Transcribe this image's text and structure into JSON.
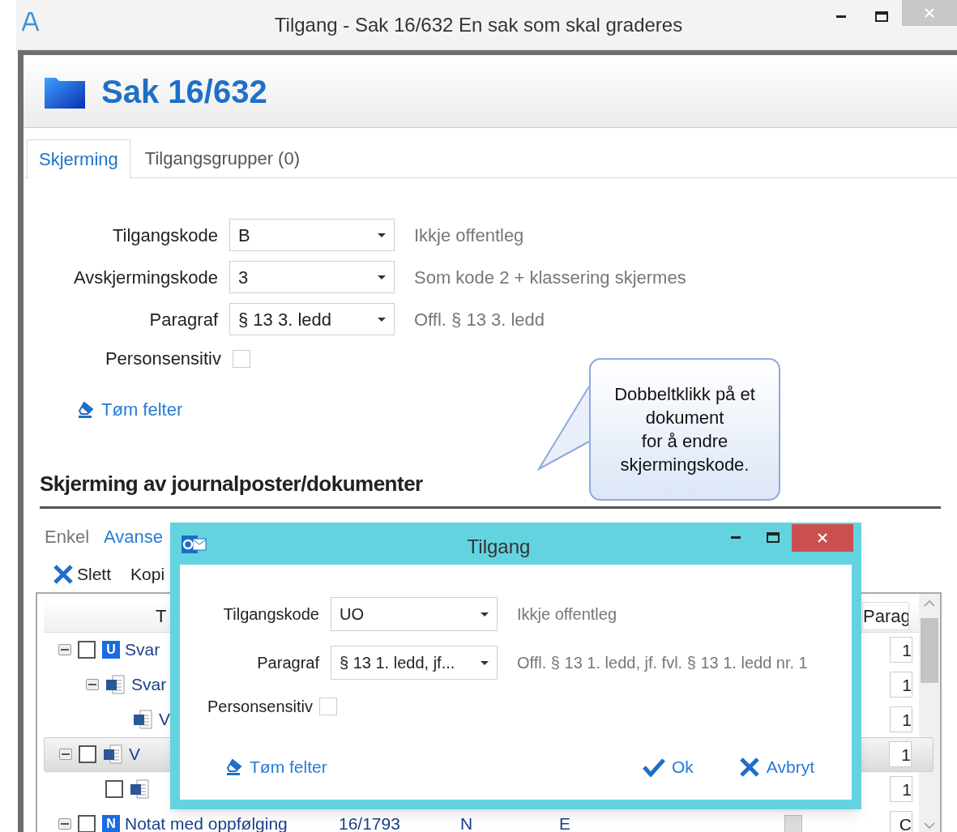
{
  "window": {
    "title": "Tilgang - Sak 16/632 En sak som skal graderes"
  },
  "header": {
    "title": "Sak 16/632"
  },
  "tabs": [
    {
      "label": "Skjerming",
      "selected": true
    },
    {
      "label": "Tilgangsgrupper (0)",
      "selected": false
    }
  ],
  "form": {
    "fields": [
      {
        "label": "Tilgangskode",
        "value": "B",
        "description": "Ikkje offentleg"
      },
      {
        "label": "Avskjermingskode",
        "value": "3",
        "description": "Som kode 2 + klassering skjermes"
      },
      {
        "label": "Paragraf",
        "value": "§ 13 3. ledd",
        "description": "Offl. § 13 3. ledd"
      }
    ],
    "checkbox": {
      "label": "Personsensitiv",
      "checked": false
    },
    "clear_link": "Tøm felter"
  },
  "callout": {
    "text": "Dobbeltklikk på et\ndokument\nfor å endre\nskjermingskode."
  },
  "section": {
    "title": "Skjerming av journalposter/dokumenter",
    "view_tabs": [
      {
        "label": "Enkel",
        "selected": false
      },
      {
        "label": "Avanse",
        "selected": true
      }
    ],
    "toolbar": [
      {
        "kind": "delete",
        "label": "Slett"
      },
      {
        "kind": "plain",
        "label": "Kopi"
      }
    ],
    "table": {
      "columns": [
        "T",
        "Parag"
      ],
      "rows": [
        {
          "expanded": true,
          "checked": false,
          "kind": "badge",
          "badge": "U",
          "title": "Svar",
          "paragraph": "1",
          "selected": false,
          "children": [
            {
              "expanded": true,
              "kind": "document",
              "title": "Svar",
              "paragraph": "1",
              "selected": false,
              "children": [
                {
                  "kind": "document",
                  "title": "V",
                  "paragraph": "1",
                  "selected": false
                }
              ]
            }
          ]
        },
        {
          "expanded": true,
          "checked": false,
          "kind": "document",
          "title": "V",
          "paragraph": "1",
          "selected": true,
          "children": [
            {
              "checked": false,
              "kind": "document",
              "paragraph": "1",
              "selected": false
            }
          ]
        },
        {
          "expanded": true,
          "checked": false,
          "kind": "badge",
          "badge": "N",
          "title": "Notat med oppfølging",
          "number": "16/1793",
          "column_3": "N",
          "column_4": "E",
          "flag": {
            "checked": false,
            "disabled": true
          },
          "paragraph": "C",
          "selected": false
        }
      ]
    }
  },
  "dialog": {
    "title": "Tilgang",
    "fields": [
      {
        "label": "Tilgangskode",
        "value": "UO",
        "description": "Ikkje offentleg"
      },
      {
        "label": "Paragraf",
        "value": "§ 13 1. ledd, jf...",
        "description": "Offl. § 13 1. ledd, jf. fvl. § 13 1. ledd nr. 1"
      }
    ],
    "checkbox": {
      "label": "Personsensitiv",
      "checked": false
    },
    "clear_link": "Tøm felter",
    "buttons": [
      {
        "kind": "ok",
        "label": "Ok"
      },
      {
        "kind": "cancel",
        "label": "Avbryt"
      }
    ]
  }
}
